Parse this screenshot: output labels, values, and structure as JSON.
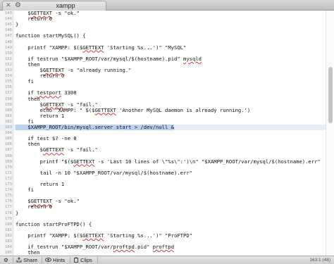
{
  "window": {
    "tab_title": "xampp",
    "close_glyph": "✕",
    "gear_glyph": "⚙"
  },
  "editor": {
    "highlighted_line": "163",
    "lines": [
      {
        "n": "143",
        "code": "    $GETTEXT -s \"ok.\""
      },
      {
        "n": "144",
        "code": "    return 0"
      },
      {
        "n": "145",
        "code": "}"
      },
      {
        "n": "146",
        "code": ""
      },
      {
        "n": "147",
        "code": "function startMySQL() {"
      },
      {
        "n": "148",
        "code": ""
      },
      {
        "n": "149",
        "code": "    printf \"XAMPP: $($GETTEXT 'Starting %s...')\" \"MySQL\""
      },
      {
        "n": "150",
        "code": ""
      },
      {
        "n": "151",
        "code": "    if testrun \"$XAMPP_ROOT/var/mysql/$(hostname).pid\" mysqld"
      },
      {
        "n": "152",
        "code": "    then"
      },
      {
        "n": "153",
        "code": "        $GETTEXT -s \"already running.\""
      },
      {
        "n": "154",
        "code": "        return 0"
      },
      {
        "n": "155",
        "code": "    fi"
      },
      {
        "n": "156",
        "code": ""
      },
      {
        "n": "157",
        "code": "    if testport 3308"
      },
      {
        "n": "158",
        "code": "    then"
      },
      {
        "n": "159",
        "code": "        $GETTEXT -s \"fail.\""
      },
      {
        "n": "160",
        "code": "        echo \"XAMPP: \" $($GETTEXT 'Another MySQL daemon is already running.')"
      },
      {
        "n": "161",
        "code": "        return 1"
      },
      {
        "n": "162",
        "code": "    fi"
      },
      {
        "n": "163",
        "code": "    $XAMPP_ROOT/bin/mysql.server start > /dev/null &"
      },
      {
        "n": "164",
        "code": ""
      },
      {
        "n": "165",
        "code": "    if test $? -ne 0"
      },
      {
        "n": "166",
        "code": "    then"
      },
      {
        "n": "167",
        "code": "        $GETTEXT -s \"fail.\""
      },
      {
        "n": "168",
        "code": ""
      },
      {
        "n": "169",
        "code": "        printf \"$($GETTEXT -s 'Last 10 lines of \\\"%s\\\":')\\n\" \"$XAMPP_ROOT/var/mysql/$(hostname).err\""
      },
      {
        "n": "170",
        "code": ""
      },
      {
        "n": "171",
        "code": "        tail -n 10 \"$XAMPP_ROOT/var/mysql/$(hostname).err\""
      },
      {
        "n": "172",
        "code": ""
      },
      {
        "n": "173",
        "code": "        return 1"
      },
      {
        "n": "174",
        "code": "    fi"
      },
      {
        "n": "175",
        "code": ""
      },
      {
        "n": "176",
        "code": "    $GETTEXT -s \"ok.\""
      },
      {
        "n": "177",
        "code": "    return 0"
      },
      {
        "n": "178",
        "code": "}"
      },
      {
        "n": "179",
        "code": ""
      },
      {
        "n": "180",
        "code": "function startProFTPD() {"
      },
      {
        "n": "181",
        "code": ""
      },
      {
        "n": "182",
        "code": "    printf \"XAMPP: $($GETTEXT 'Starting %s...')\" \"ProFTPD\""
      },
      {
        "n": "183",
        "code": ""
      },
      {
        "n": "184",
        "code": "    if testrun \"$XAMPP_ROOT/var/proftpd.pid\" proftpd"
      },
      {
        "n": "185",
        "code": "    then"
      }
    ]
  },
  "statusbar": {
    "settings_glyph": "⚙",
    "share_label": "Share",
    "hints_label": "Hints",
    "clips_label": "Clips",
    "share_icon": "share-icon",
    "hints_icon": "eye-icon",
    "clips_icon": "clipboard-icon",
    "position": "163:1 (48)"
  }
}
